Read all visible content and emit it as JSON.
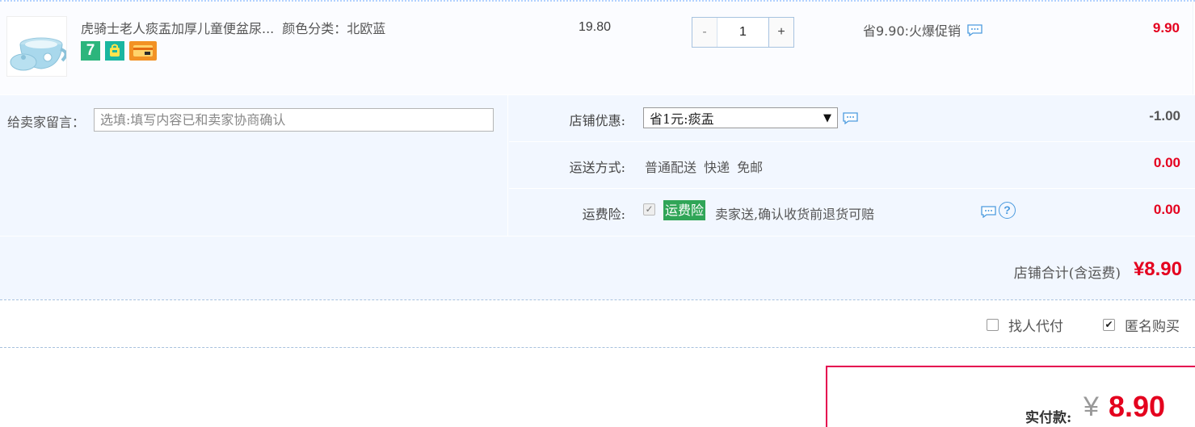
{
  "item": {
    "title": "虎骑士老人痰盂加厚儿童便盆尿...",
    "sku": "颜色分类：北欧蓝",
    "price": "19.80",
    "quantity": "1",
    "qty_minus": "-",
    "qty_plus": "+",
    "promo": "省9.90:火爆促销",
    "subtotal": "9.90",
    "badges": [
      {
        "icon": "seven-day-return-icon",
        "text": "7"
      },
      {
        "icon": "shopping-bag-icon"
      },
      {
        "icon": "credit-card-icon"
      }
    ]
  },
  "memo": {
    "label": "给卖家留言：",
    "placeholder": "选填:填写内容已和卖家协商确认"
  },
  "discount": {
    "label": "店铺优惠:",
    "selected": "省1元:痰盂",
    "amount": "-1.00"
  },
  "shipping": {
    "label": "运送方式:",
    "method": "普通配送 快递 免邮",
    "amount": "0.00"
  },
  "insurance": {
    "label": "运费险:",
    "tag": "运费险",
    "desc": "卖家送,确认收货前退货可赔",
    "amount": "0.00",
    "checked": true
  },
  "store_total": {
    "label": "店铺合计(含运费)",
    "value": "¥8.90"
  },
  "pay_options": {
    "find_someone": "找人代付",
    "anonymous": "匿名购买"
  },
  "final": {
    "label": "实付款:",
    "currency": "¥",
    "value": "8.90"
  },
  "colors": {
    "accent_red": "#e4001e",
    "insurance_green": "#30a557",
    "panel_bg": "#f2f7ff"
  }
}
